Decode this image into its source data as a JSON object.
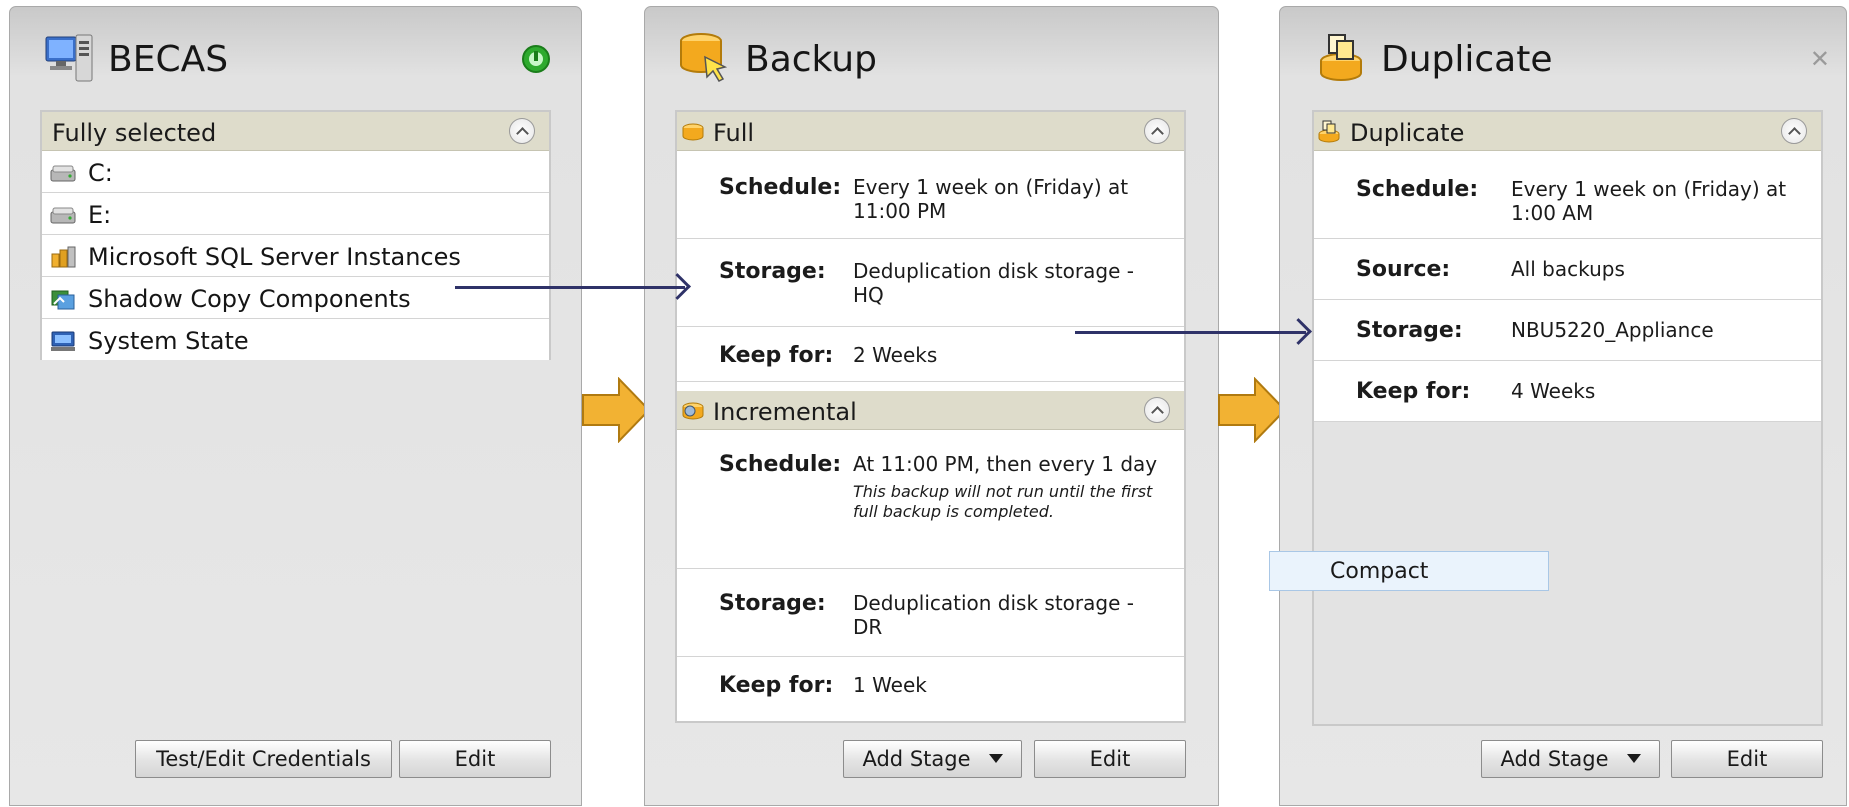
{
  "becas": {
    "title": "BECAS",
    "section_label": "Fully selected",
    "items": [
      {
        "label": "C:",
        "icon": "drive-icon"
      },
      {
        "label": "E:",
        "icon": "drive-icon"
      },
      {
        "label": "Microsoft SQL Server Instances",
        "icon": "sql-server-icon"
      },
      {
        "label": "Shadow Copy Components",
        "icon": "shadow-copy-icon"
      },
      {
        "label": "System State",
        "icon": "system-state-icon"
      }
    ],
    "credentials_button": "Test/Edit Credentials",
    "edit_button": "Edit",
    "status_color": "#2eaa2e"
  },
  "backup": {
    "title": "Backup",
    "full": {
      "label": "Full",
      "schedule_key": "Schedule:",
      "schedule_val": "Every 1 week on (Friday) at 11:00 PM",
      "storage_key": "Storage:",
      "storage_val": "Deduplication disk storage - HQ",
      "keep_key": "Keep for:",
      "keep_val": "2 Weeks"
    },
    "incremental": {
      "label": "Incremental",
      "schedule_key": "Schedule:",
      "schedule_val": "At 11:00 PM, then every 1 day",
      "schedule_note": "This backup will not run until the first full backup is completed.",
      "storage_key": "Storage:",
      "storage_val": "Deduplication disk storage - DR",
      "keep_key": "Keep for:",
      "keep_val": "1 Week"
    },
    "add_stage_button": "Add Stage",
    "edit_button": "Edit"
  },
  "duplicate": {
    "title": "Duplicate",
    "close_glyph": "✕",
    "section_label": "Duplicate",
    "schedule_key": "Schedule:",
    "schedule_val": "Every 1 week on (Friday) at 1:00 AM",
    "source_key": "Source:",
    "source_val": "All backups",
    "storage_key": "Storage:",
    "storage_val": "NBU5220_Appliance",
    "keep_key": "Keep for:",
    "keep_val": "4 Weeks",
    "add_stage_button": "Add Stage",
    "edit_button": "Edit"
  },
  "tooltip": {
    "label": "Compact"
  },
  "colors": {
    "arrow": "#2f3268",
    "stage_arrow": "#f2b233",
    "header_band": "#dedccb"
  }
}
